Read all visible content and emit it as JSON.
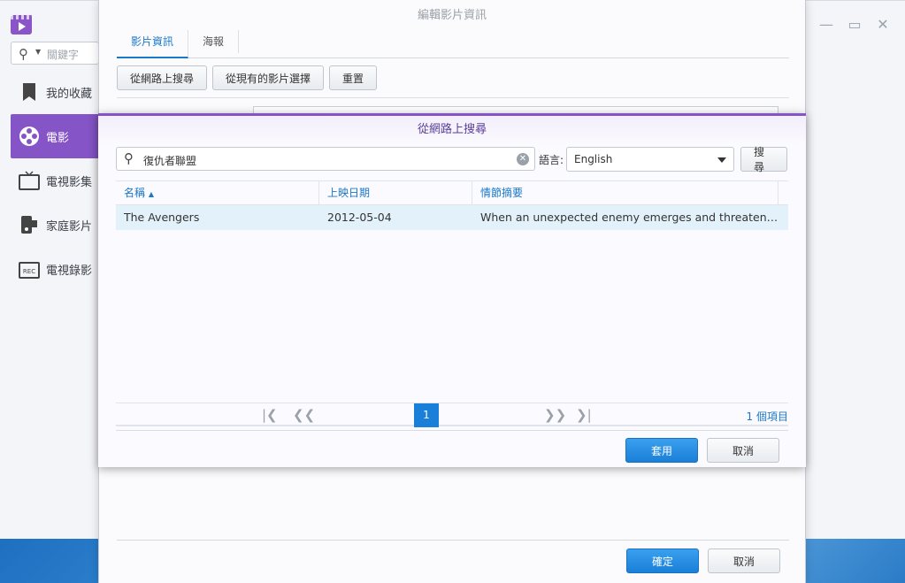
{
  "app": {
    "search_placeholder": "關鍵字",
    "window_controls": [
      "minimize-icon",
      "maximize-icon",
      "close-icon"
    ]
  },
  "sidebar": {
    "items": [
      {
        "label": "我的收藏",
        "icon": "bookmark-icon",
        "active": false
      },
      {
        "label": "電影",
        "icon": "film-reel-icon",
        "active": true
      },
      {
        "label": "電視影集",
        "icon": "tv-icon",
        "active": false
      },
      {
        "label": "家庭影片",
        "icon": "camcorder-icon",
        "active": false
      },
      {
        "label": "電視錄影",
        "icon": "tv-rec-icon",
        "active": false
      }
    ]
  },
  "edit_dialog": {
    "title": "編輯影片資訊",
    "tabs": [
      "影片資訊",
      "海報"
    ],
    "buttons": {
      "search_online": "從網路上搜尋",
      "select_existing": "從現有的影片選擇",
      "reset": "重置"
    },
    "ok": "確定",
    "cancel": "取消"
  },
  "search_dialog": {
    "title": "從網路上搜尋",
    "keyword": "復仇者聯盟",
    "language_label": "語言:",
    "language_value": "English",
    "search_button": "搜尋",
    "columns": [
      "名稱",
      "上映日期",
      "情節摘要"
    ],
    "rows": [
      {
        "name": "The Avengers",
        "date": "2012-05-04",
        "summary": "When an unexpected enemy emerges and threatens global safety and security, Nick Fury"
      }
    ],
    "pager": {
      "current_page": "1",
      "count": "1 個項目"
    },
    "apply": "套用",
    "cancel": "取消"
  },
  "colors": {
    "accent_purple": "#8554c6",
    "accent_blue": "#1a7fd8",
    "selected_row": "#e3f1fb"
  }
}
